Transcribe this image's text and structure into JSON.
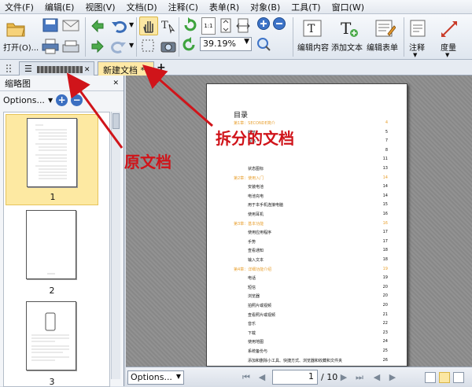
{
  "menu": [
    "文件(F)",
    "编辑(E)",
    "视图(V)",
    "文档(D)",
    "注释(C)",
    "表单(R)",
    "对象(B)",
    "工具(T)",
    "窗口(W)"
  ],
  "toolbar": {
    "open_label": "打开(O)...",
    "zoom_value": "39.19%",
    "zoom_page_small": "1:1",
    "edit_content_label": "编辑内容",
    "add_text_label": "添加文本",
    "edit_form_label": "编辑表单",
    "annotate_label": "注释",
    "measure_label": "度量"
  },
  "tabs": {
    "original_tab_label": "",
    "new_doc_tab_label": "新建文档 *"
  },
  "sidebar": {
    "title": "缩略图",
    "options_label": "Options...",
    "thumbnails": [
      {
        "number": "1",
        "selected": true
      },
      {
        "number": "2",
        "selected": false
      },
      {
        "number": "3",
        "selected": false
      }
    ]
  },
  "document": {
    "toc_title": "目录",
    "toc_entries": [
      {
        "text": "第1章：SECONDE简介",
        "page": "4",
        "chapter": true
      },
      {
        "text": "概览",
        "page": "5",
        "chapter": false
      },
      {
        "text": "规格",
        "page": "7",
        "chapter": false
      },
      {
        "text": "",
        "page": "8",
        "chapter": false
      },
      {
        "text": "",
        "page": "11",
        "chapter": false
      },
      {
        "text": "状态图标",
        "page": "13",
        "chapter": false
      },
      {
        "text": "第2章：使用入门",
        "page": "14",
        "chapter": true
      },
      {
        "text": "安装电池",
        "page": "14",
        "chapter": false
      },
      {
        "text": "电池充电",
        "page": "14",
        "chapter": false
      },
      {
        "text": "用于本手机连接电脑",
        "page": "15",
        "chapter": false
      },
      {
        "text": "使用耳机",
        "page": "16",
        "chapter": false
      },
      {
        "text": "第3章：基本功能",
        "page": "16",
        "chapter": true
      },
      {
        "text": "使用应用程序",
        "page": "17",
        "chapter": false
      },
      {
        "text": "手势",
        "page": "17",
        "chapter": false
      },
      {
        "text": "查看通知",
        "page": "18",
        "chapter": false
      },
      {
        "text": "输入文本",
        "page": "18",
        "chapter": false
      },
      {
        "text": "第4章：详细功能介绍",
        "page": "19",
        "chapter": true
      },
      {
        "text": "电话",
        "page": "19",
        "chapter": false
      },
      {
        "text": "短信",
        "page": "20",
        "chapter": false
      },
      {
        "text": "浏览器",
        "page": "20",
        "chapter": false
      },
      {
        "text": "拍照片或视频",
        "page": "20",
        "chapter": false
      },
      {
        "text": "查看照片或视频",
        "page": "21",
        "chapter": false
      },
      {
        "text": "音乐",
        "page": "22",
        "chapter": false
      },
      {
        "text": "下载",
        "page": "23",
        "chapter": false
      },
      {
        "text": "使用地图",
        "page": "24",
        "chapter": false
      },
      {
        "text": "系统备份与",
        "page": "25",
        "chapter": false
      },
      {
        "text": "添加和删除小工具、快捷方式、浏览器和收藏和文件夹",
        "page": "26",
        "chapter": false
      },
      {
        "text": "",
        "page": "26",
        "chapter": false
      }
    ]
  },
  "status": {
    "options_label": "Options...",
    "page_current": "1",
    "page_total": "/ 10"
  },
  "annotations": {
    "original_doc_label": "原文档",
    "split_doc_label": "拆分的文档",
    "color": "#d0141a"
  }
}
